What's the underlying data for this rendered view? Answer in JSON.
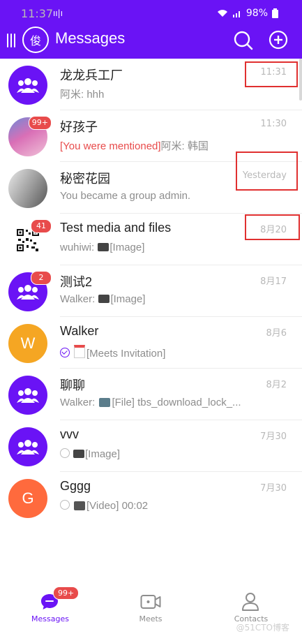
{
  "status": {
    "time": "11:37",
    "battery": "98%"
  },
  "header": {
    "title": "Messages",
    "avatar_char": "俊"
  },
  "chats": [
    {
      "name": "龙龙兵工厂",
      "time": "11:31",
      "preview": "阿米: hhh",
      "avatar": "group"
    },
    {
      "name": "好孩子",
      "time": "11:30",
      "mention": "[You were mentioned]",
      "preview": "阿米: 韩国",
      "avatar": "photo-gradient",
      "badge": "99+"
    },
    {
      "name": "秘密花园",
      "time": "Yesterday",
      "preview": "You became a group admin.",
      "avatar": "photo-gray"
    },
    {
      "name": "Test media and files",
      "time": "8月20",
      "preview_prefix": "wuhiwi: ",
      "preview_tail": "[Image]",
      "avatar": "qr",
      "badge": "41"
    },
    {
      "name": "测试2",
      "time": "8月17",
      "preview_prefix": "Walker: ",
      "preview_tail": "[Image]",
      "avatar": "group",
      "badge": "2"
    },
    {
      "name": "Walker",
      "time": "8月6",
      "preview_tail": "[Meets Invitation]",
      "avatar_letter": "W",
      "avatar_color": "#f5a623"
    },
    {
      "name": "聊聊",
      "time": "8月2",
      "preview_prefix": "Walker: ",
      "preview_tail": "[File] tbs_download_lock_...",
      "avatar": "group"
    },
    {
      "name": "vvv",
      "time": "7月30",
      "preview_tail": "[Image]",
      "avatar": "group"
    },
    {
      "name": "Gggg",
      "time": "7月30",
      "preview_tail": "[Video] 00:02",
      "avatar_letter": "G",
      "avatar_color": "#ff6a3d"
    }
  ],
  "tabs": [
    {
      "label": "Messages",
      "badge": "99+"
    },
    {
      "label": "Meets"
    },
    {
      "label": "Contacts"
    }
  ],
  "watermark": "@51CTO博客",
  "colors": {
    "brand": "#6a13f5",
    "badge": "#e84b4b",
    "highlight": "#e03030"
  }
}
